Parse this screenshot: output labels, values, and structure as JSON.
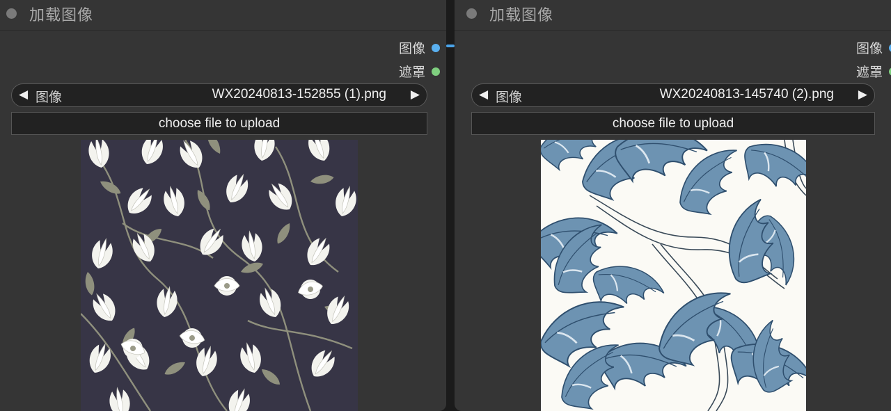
{
  "nodes": [
    {
      "title": "加载图像",
      "outputs": {
        "image": "图像",
        "mask": "遮罩"
      },
      "combo": {
        "label": "图像",
        "value": "WX20240813-152855 (1).png",
        "prev_arrow": "◀",
        "next_arrow": "▶"
      },
      "upload_label": "choose file to upload",
      "preview": {
        "pattern": "white-magnolia-floral-on-dark-navy",
        "colors": [
          "#373546",
          "#f3f3ee",
          "#8f907d"
        ]
      }
    },
    {
      "title": "加载图像",
      "outputs": {
        "image": "图像",
        "mask": "遮罩"
      },
      "combo": {
        "label": "图像",
        "value": "WX20240813-145740 (2).png",
        "prev_arrow": "◀",
        "next_arrow": "▶"
      },
      "upload_label": "choose file to upload",
      "preview": {
        "pattern": "blue-acanthus-leaf-on-cream",
        "colors": [
          "#fbfaf5",
          "#5f86a6",
          "#2f4f6e"
        ]
      }
    }
  ],
  "colors": {
    "node_bg": "#353535",
    "canvas_bg": "#1b1b1b",
    "image_port": "#5ab0f0",
    "mask_port": "#7fcf7f",
    "link": "#4aa3e8"
  }
}
